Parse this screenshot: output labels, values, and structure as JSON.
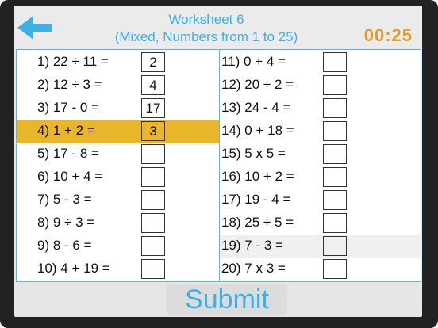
{
  "header": {
    "title_line1": "Worksheet 6",
    "title_line2": "(Mixed, Numbers from 1 to 25)",
    "timer": "00:25",
    "back_icon": "arrow-left-icon",
    "accent_color": "#3cb1e6",
    "timer_color": "#e59a28"
  },
  "left_questions": [
    {
      "label": "1)  22 ÷ 11 =",
      "answer": "2"
    },
    {
      "label": "2)  12 ÷ 3 =",
      "answer": "4"
    },
    {
      "label": "3)  17 - 0 =",
      "answer": "17"
    },
    {
      "label": "4)  1 + 2 =",
      "answer": "3"
    },
    {
      "label": "5)  17 - 8 =",
      "answer": ""
    },
    {
      "label": "6)  10 + 4 =",
      "answer": ""
    },
    {
      "label": "7)  5 - 3 =",
      "answer": ""
    },
    {
      "label": "8)  9 ÷ 3 =",
      "answer": ""
    },
    {
      "label": "9)  8 - 6 =",
      "answer": ""
    },
    {
      "label": "10)  4 + 19 =",
      "answer": ""
    }
  ],
  "right_questions": [
    {
      "label": "11)  0 + 4 =",
      "answer": ""
    },
    {
      "label": "12)  20 ÷ 2 =",
      "answer": ""
    },
    {
      "label": "13)  24 - 4 =",
      "answer": ""
    },
    {
      "label": "14)  0 + 18 =",
      "answer": ""
    },
    {
      "label": "15)  5 x 5 =",
      "answer": ""
    },
    {
      "label": "16)  10 + 2 =",
      "answer": ""
    },
    {
      "label": "17)  19 - 4 =",
      "answer": ""
    },
    {
      "label": "18)  25 ÷ 5 =",
      "answer": ""
    },
    {
      "label": "19)  7 - 3 =",
      "answer": ""
    },
    {
      "label": "20)  7 x 3 =",
      "answer": ""
    }
  ],
  "active_question": "4",
  "submit_label": "Submit"
}
